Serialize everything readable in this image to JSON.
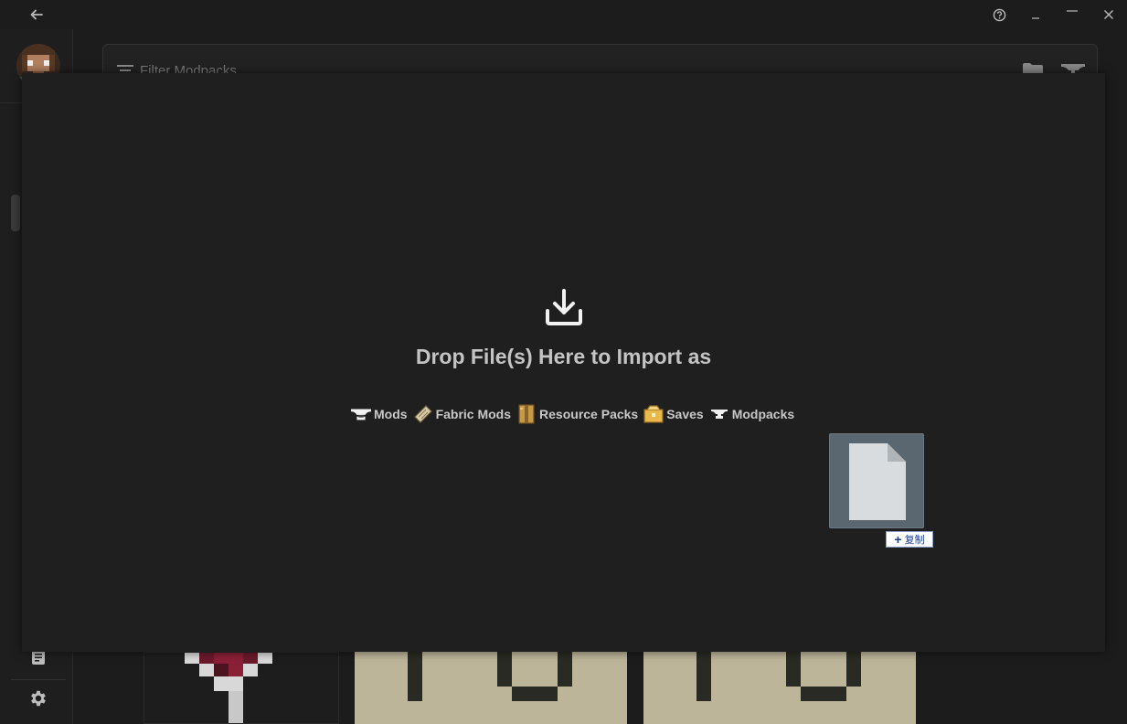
{
  "window": {
    "icons": [
      "back-arrow-icon",
      "help-icon",
      "minimize-icon",
      "maximize-icon",
      "close-icon"
    ]
  },
  "filter": {
    "placeholder": "Filter Modpacks"
  },
  "overlay": {
    "title": "Drop File(s) Here to Import as",
    "types": [
      {
        "label": "Mods",
        "icon": "anvil-icon"
      },
      {
        "label": "Fabric Mods",
        "icon": "fabric-icon"
      },
      {
        "label": "Resource Packs",
        "icon": "resource-pack-icon"
      },
      {
        "label": "Saves",
        "icon": "save-chest-icon"
      },
      {
        "label": "Modpacks",
        "icon": "modpack-icon"
      }
    ]
  },
  "drag": {
    "badge_label": "复制",
    "badge_prefix": "+"
  },
  "colors": {
    "background": "#1c1c1c",
    "overlay": "#1f1f1f",
    "text": "#c4c4c4",
    "drag_ghost": "#5b6770"
  }
}
